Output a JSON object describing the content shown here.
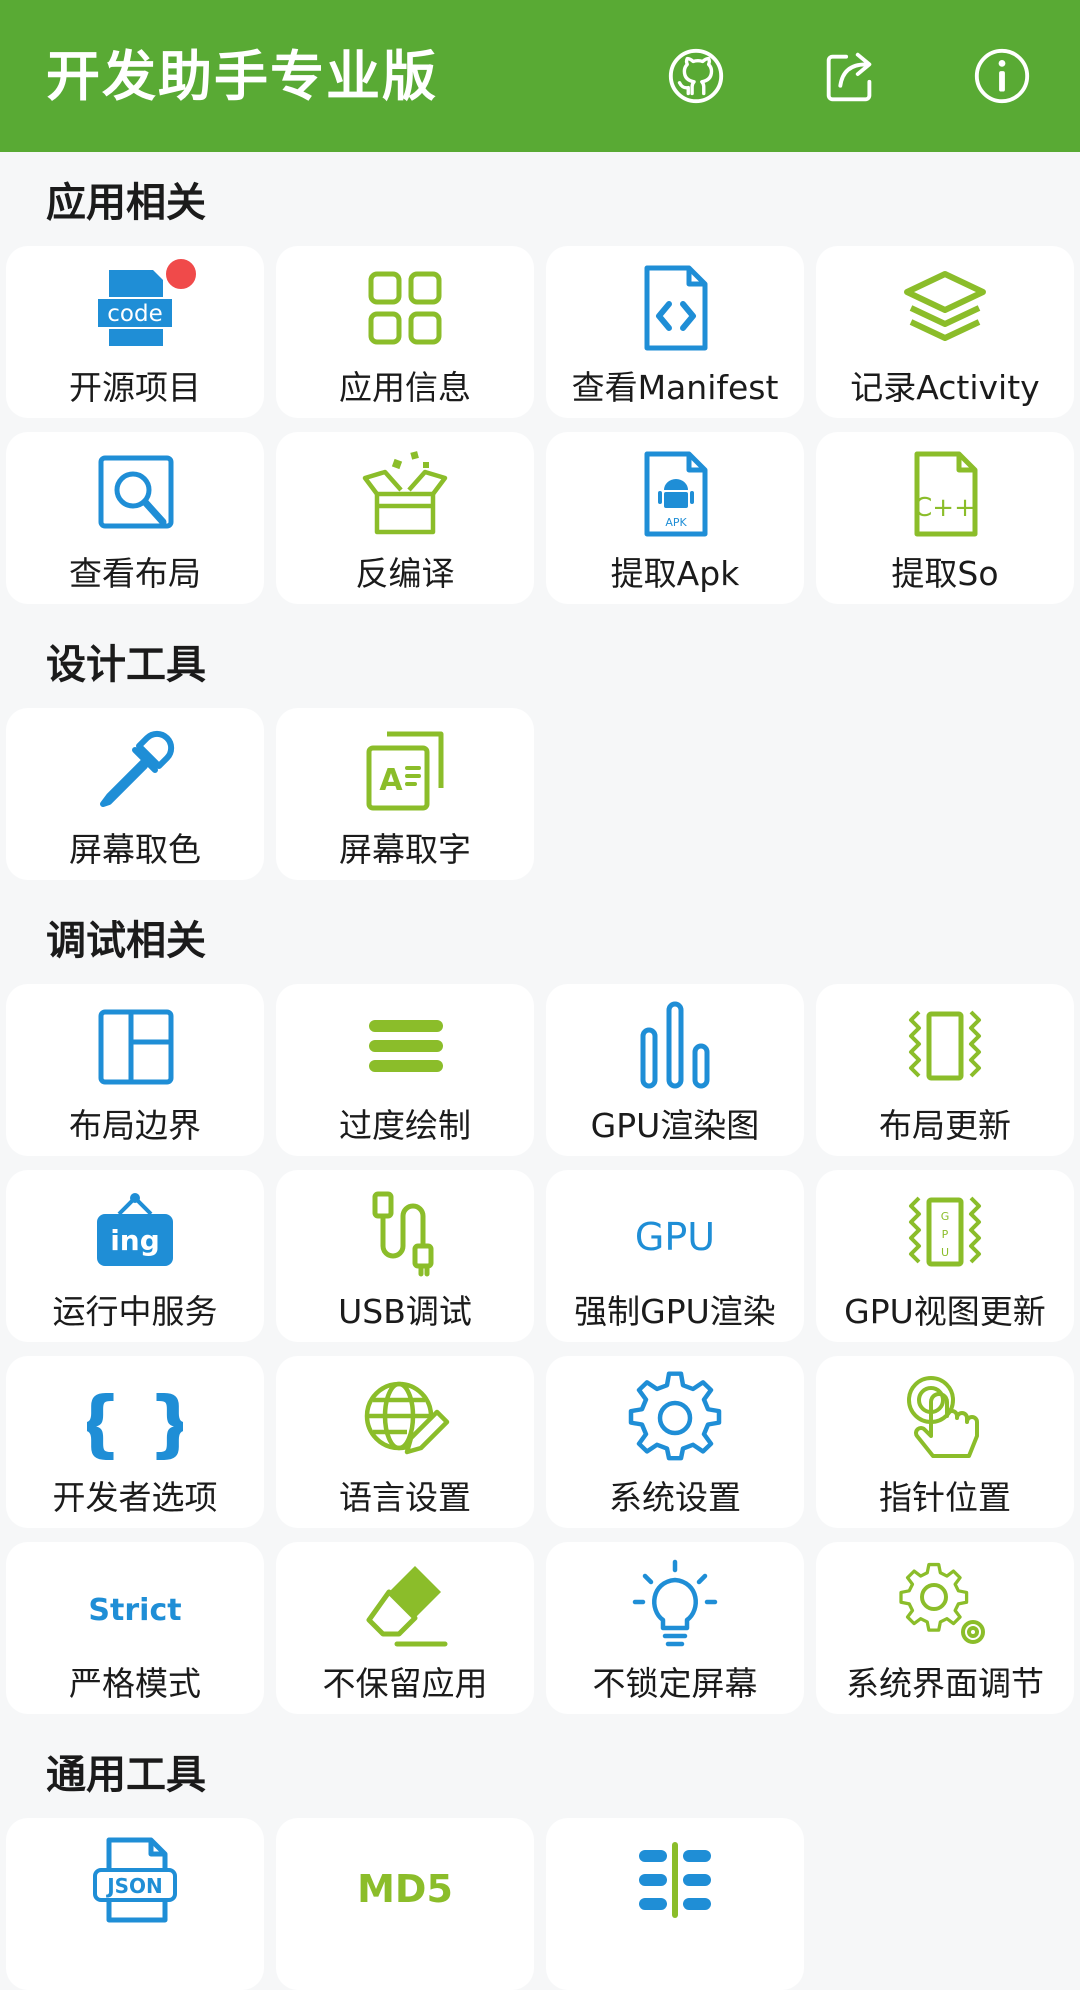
{
  "appbar": {
    "title": "开发助手专业版",
    "actions": [
      {
        "name": "github-button",
        "icon": "github-icon"
      },
      {
        "name": "share-button",
        "icon": "share-icon"
      },
      {
        "name": "info-button",
        "icon": "info-icon"
      }
    ]
  },
  "colors": {
    "primary": "#59aa34",
    "green_icon": "#8bbd2a",
    "blue_icon": "#1f8ed6",
    "badge": "#f04a4a",
    "background": "#f6f7f8"
  },
  "sections": {
    "app": {
      "title": "应用相关",
      "items": [
        {
          "label": "开源项目",
          "icon": "code-icon"
        },
        {
          "label": "应用信息",
          "icon": "grid-icon"
        },
        {
          "label": "查看Manifest",
          "icon": "code-file-icon"
        },
        {
          "label": "记录Activity",
          "icon": "layers-icon"
        },
        {
          "label": "查看布局",
          "icon": "search-layout-icon"
        },
        {
          "label": "反编译",
          "icon": "open-box-icon"
        },
        {
          "label": "提取Apk",
          "icon": "apk-file-icon"
        },
        {
          "label": "提取So",
          "icon": "cpp-file-icon"
        }
      ]
    },
    "design": {
      "title": "设计工具",
      "items": [
        {
          "label": "屏幕取色",
          "icon": "eyedropper-icon"
        },
        {
          "label": "屏幕取字",
          "icon": "text-capture-icon"
        }
      ]
    },
    "debug": {
      "title": "调试相关",
      "items": [
        {
          "label": "布局边界",
          "icon": "layout-bounds-icon"
        },
        {
          "label": "过度绘制",
          "icon": "menu-lines-icon"
        },
        {
          "label": "GPU渲染图",
          "icon": "bar-chart-icon"
        },
        {
          "label": "布局更新",
          "icon": "layout-update-icon"
        },
        {
          "label": "运行中服务",
          "icon": "ing-sign-icon"
        },
        {
          "label": "USB调试",
          "icon": "usb-cable-icon"
        },
        {
          "label": "强制GPU渲染",
          "icon": "gpu-text-icon"
        },
        {
          "label": "GPU视图更新",
          "icon": "gpu-view-update-icon"
        },
        {
          "label": "开发者选项",
          "icon": "braces-icon"
        },
        {
          "label": "语言设置",
          "icon": "globe-pencil-icon"
        },
        {
          "label": "系统设置",
          "icon": "gear-icon"
        },
        {
          "label": "指针位置",
          "icon": "touch-pointer-icon"
        },
        {
          "label": "严格模式",
          "icon": "strict-text-icon"
        },
        {
          "label": "不保留应用",
          "icon": "eraser-icon"
        },
        {
          "label": "不锁定屏幕",
          "icon": "lightbulb-icon"
        },
        {
          "label": "系统界面调节",
          "icon": "gears-icon"
        }
      ]
    },
    "general": {
      "title": "通用工具",
      "items": [
        {
          "label": "",
          "icon": "json-file-icon",
          "glyph": "JSON"
        },
        {
          "label": "",
          "icon": "md5-text-icon",
          "glyph": "MD5"
        },
        {
          "label": "",
          "icon": "timeline-icon"
        }
      ]
    }
  }
}
